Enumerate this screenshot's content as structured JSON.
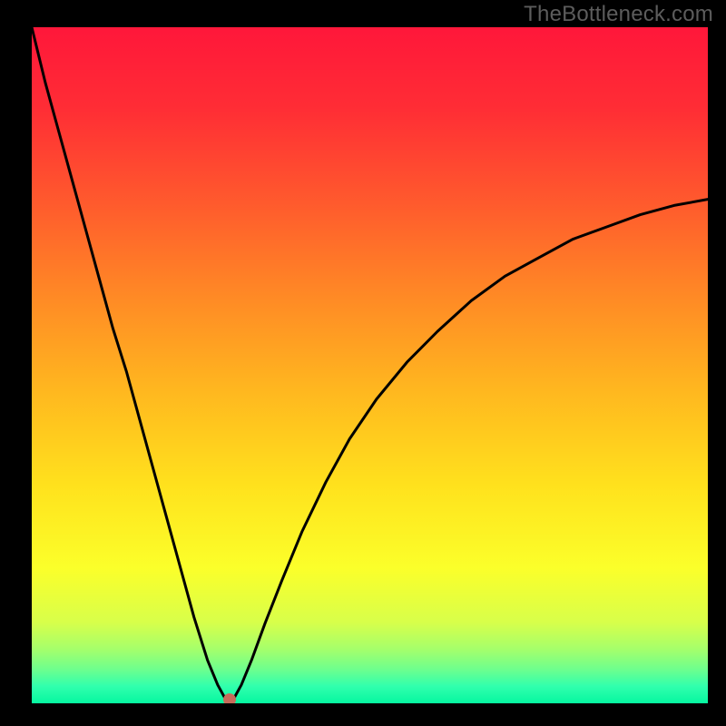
{
  "watermark": "TheBottleneck.com",
  "colors": {
    "frame": "#000000",
    "curve": "#000000",
    "gradient_stops": [
      {
        "offset": 0.0,
        "color": "#ff173a"
      },
      {
        "offset": 0.12,
        "color": "#ff2d35"
      },
      {
        "offset": 0.26,
        "color": "#ff5a2d"
      },
      {
        "offset": 0.4,
        "color": "#ff8a25"
      },
      {
        "offset": 0.54,
        "color": "#ffb81f"
      },
      {
        "offset": 0.68,
        "color": "#ffe21d"
      },
      {
        "offset": 0.8,
        "color": "#fbff2a"
      },
      {
        "offset": 0.88,
        "color": "#d8ff4a"
      },
      {
        "offset": 0.92,
        "color": "#a5ff6b"
      },
      {
        "offset": 0.95,
        "color": "#6dff8e"
      },
      {
        "offset": 0.975,
        "color": "#30ffad"
      },
      {
        "offset": 1.0,
        "color": "#06f7a0"
      }
    ],
    "dot": "#c76b5a"
  },
  "chart_data": {
    "type": "line",
    "title": "",
    "xlabel": "",
    "ylabel": "",
    "xlim": [
      0,
      1
    ],
    "ylim": [
      0,
      1.1
    ],
    "grid": false,
    "legend": false,
    "comment": "Two-branch curve. Left branch descends steeply from upper-left to a minimum near x≈0.29; right branch rises with decreasing slope from the minimum toward ~0.82 at x=1. Values are read off the plotted curve (normalized to plot area).",
    "series": [
      {
        "name": "curve",
        "x": [
          0.0,
          0.02,
          0.04,
          0.06,
          0.08,
          0.1,
          0.12,
          0.14,
          0.16,
          0.18,
          0.2,
          0.22,
          0.24,
          0.26,
          0.275,
          0.285,
          0.295,
          0.3,
          0.31,
          0.325,
          0.345,
          0.37,
          0.4,
          0.435,
          0.47,
          0.51,
          0.555,
          0.6,
          0.65,
          0.7,
          0.75,
          0.8,
          0.85,
          0.9,
          0.95,
          1.0
        ],
        "y": [
          1.1,
          1.01,
          0.93,
          0.85,
          0.77,
          0.69,
          0.61,
          0.54,
          0.46,
          0.38,
          0.3,
          0.22,
          0.14,
          0.07,
          0.03,
          0.01,
          0.005,
          0.01,
          0.03,
          0.07,
          0.13,
          0.2,
          0.28,
          0.36,
          0.43,
          0.495,
          0.555,
          0.605,
          0.655,
          0.695,
          0.725,
          0.755,
          0.775,
          0.795,
          0.81,
          0.82
        ]
      }
    ],
    "marker": {
      "x": 0.293,
      "y": 0.006
    }
  }
}
